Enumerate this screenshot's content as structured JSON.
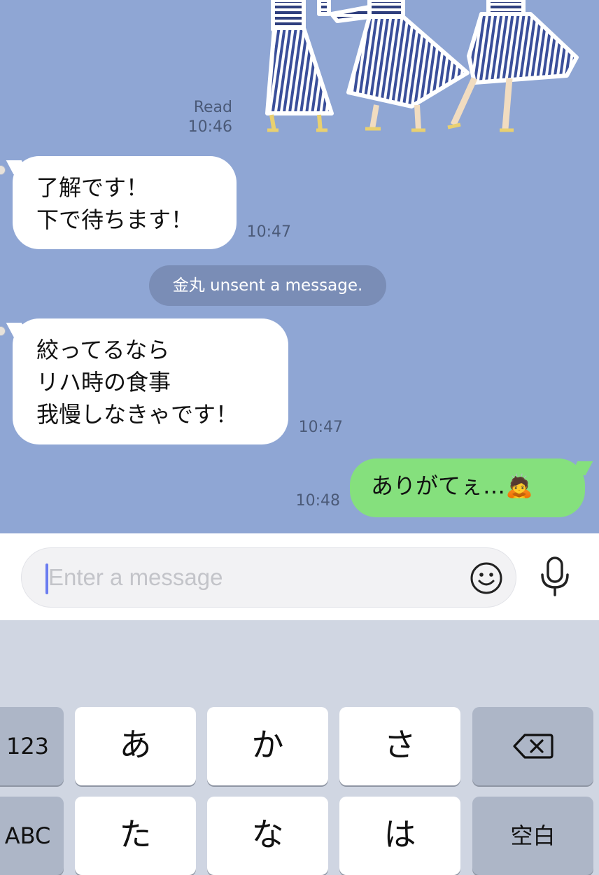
{
  "chat": {
    "background_color": "#8fa6d4",
    "sticker": {
      "icon": "striped-skirt-figures-sticker"
    },
    "read_status": "Read",
    "read_time": "10:46",
    "messages": [
      {
        "sender": "other",
        "lines": [
          "了解です！",
          "下で待ちます！"
        ],
        "time": "10:47"
      },
      {
        "sender": "other",
        "lines": [
          "絞ってるなら",
          "リハ時の食事",
          "我慢しなきゃです！"
        ],
        "time": "10:47"
      },
      {
        "sender": "me",
        "lines": [
          "ありがてぇ…🙇"
        ],
        "time": "10:48"
      }
    ],
    "system_notice": "金丸 unsent a message."
  },
  "input": {
    "placeholder": "Enter a message",
    "emoji_icon": "smiley-face-icon",
    "mic_icon": "microphone-icon"
  },
  "keyboard": {
    "row1": {
      "left": "123",
      "keys": [
        "あ",
        "か",
        "さ"
      ],
      "right_icon": "backspace-icon"
    },
    "row2": {
      "left": "ABC",
      "keys": [
        "た",
        "な",
        "は"
      ],
      "right": "空白"
    }
  },
  "colors": {
    "bubble_other": "#ffffff",
    "bubble_me": "#85e07d",
    "system_pill": "#7a8db6",
    "caret": "#6a7cf0"
  }
}
